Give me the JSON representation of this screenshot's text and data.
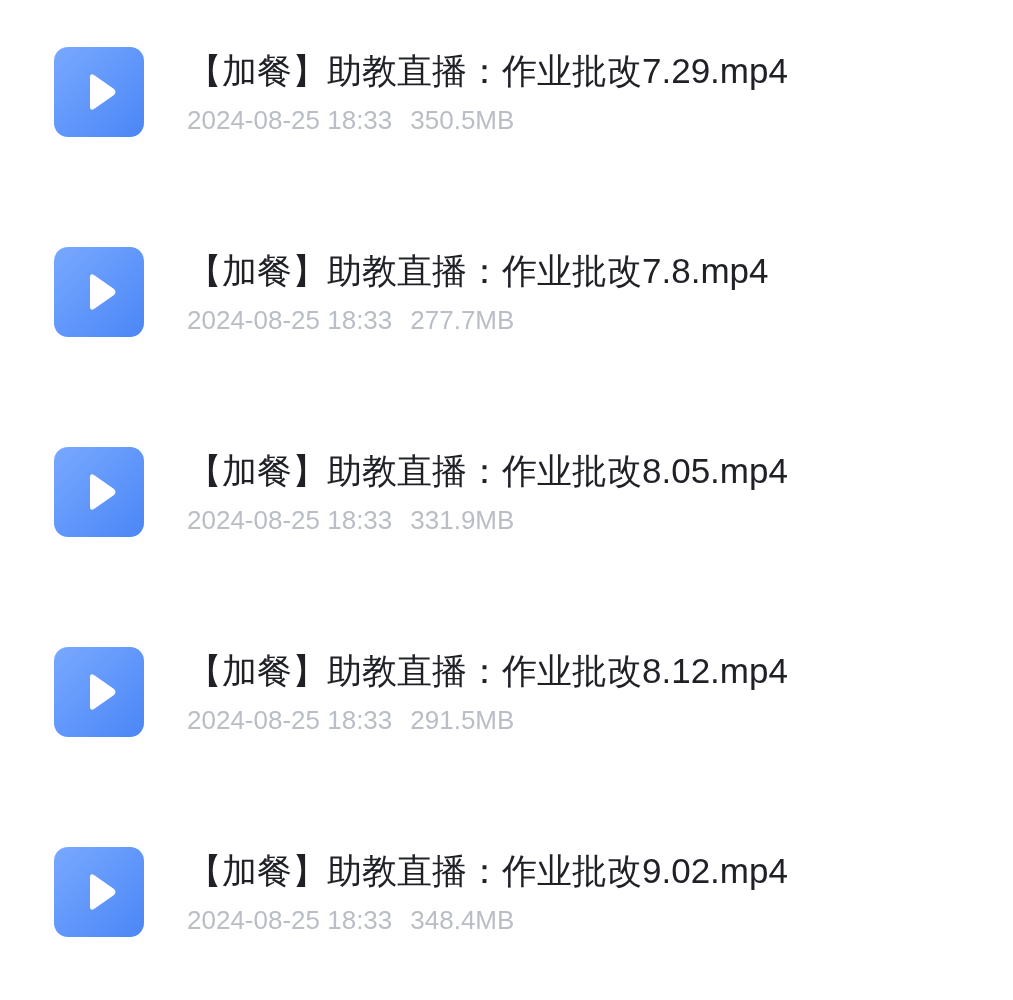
{
  "files": [
    {
      "name": "【加餐】助教直播：作业批改7.29.mp4",
      "date": "2024-08-25 18:33",
      "size": "350.5MB"
    },
    {
      "name": "【加餐】助教直播：作业批改7.8.mp4",
      "date": "2024-08-25 18:33",
      "size": "277.7MB"
    },
    {
      "name": "【加餐】助教直播：作业批改8.05.mp4",
      "date": "2024-08-25 18:33",
      "size": "331.9MB"
    },
    {
      "name": "【加餐】助教直播：作业批改8.12.mp4",
      "date": "2024-08-25 18:33",
      "size": "291.5MB"
    },
    {
      "name": "【加餐】助教直播：作业批改9.02.mp4",
      "date": "2024-08-25 18:33",
      "size": "348.4MB"
    }
  ]
}
